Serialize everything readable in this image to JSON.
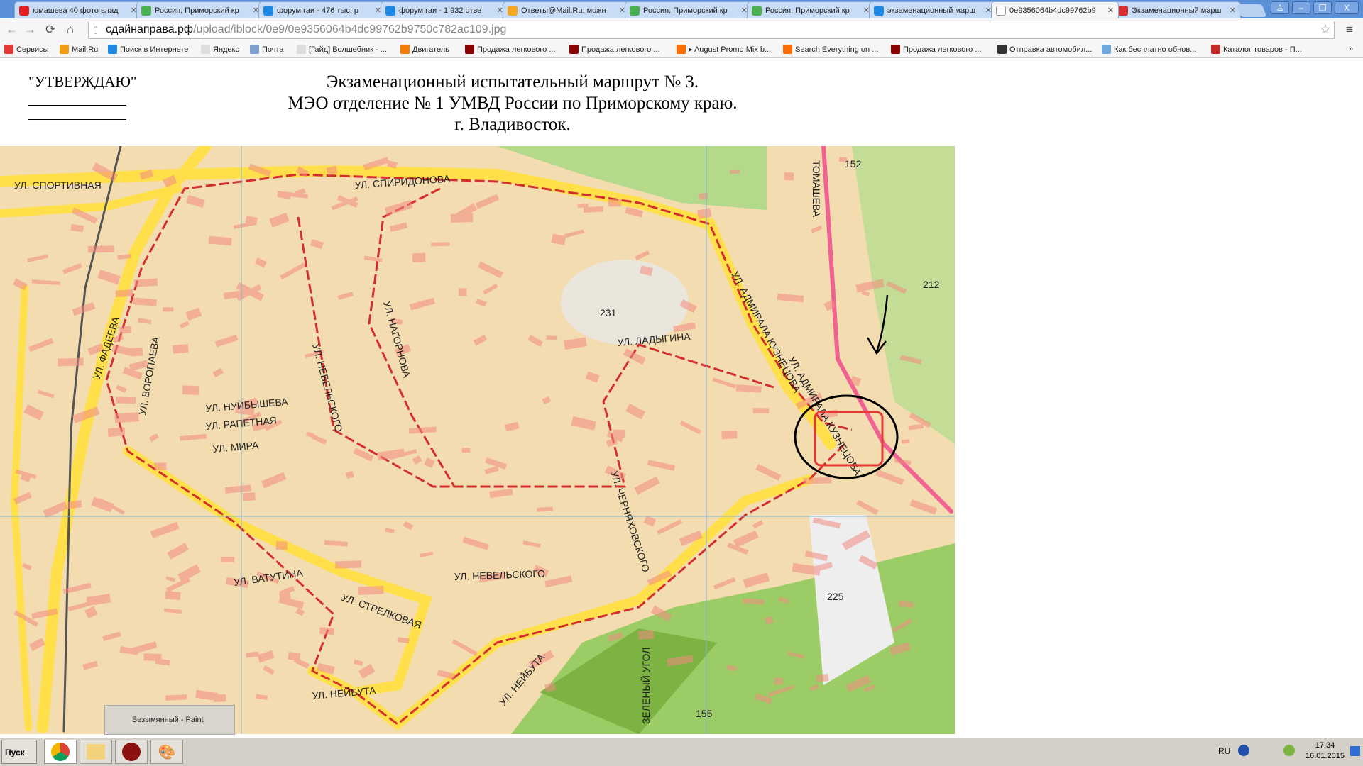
{
  "browser": {
    "tabs": [
      {
        "label": "юмашева 40 фото влад",
        "icon": "yandex-icon",
        "color": "#e02020",
        "active": false
      },
      {
        "label": "Россия, Приморский кр",
        "icon": "2gis-icon",
        "color": "#4caf50",
        "active": false
      },
      {
        "label": "форум гаи - 476 тыс. р",
        "icon": "search-icon",
        "color": "#1e88e5",
        "active": false
      },
      {
        "label": "форум гаи - 1 932 отве",
        "icon": "search-icon",
        "color": "#1e88e5",
        "active": false
      },
      {
        "label": "Ответы@Mail.Ru: можн",
        "icon": "question-icon",
        "color": "#f5a623",
        "active": false
      },
      {
        "label": "Россия, Приморский кр",
        "icon": "2gis-icon",
        "color": "#4caf50",
        "active": false
      },
      {
        "label": "Россия, Приморский кр",
        "icon": "2gis-icon",
        "color": "#4caf50",
        "active": false
      },
      {
        "label": "экзаменационный марш",
        "icon": "search-icon",
        "color": "#1e88e5",
        "active": false
      },
      {
        "label": "0e9356064b4dc99762b9",
        "icon": "file-icon",
        "color": "#ffffff",
        "active": true
      },
      {
        "label": "Экзаменационный марш",
        "icon": "site-icon",
        "color": "#d32f2f",
        "active": false
      }
    ],
    "address": {
      "host": "сдайнаправа.рф",
      "path": "/upload/iblock/0e9/0e9356064b4dc99762b9750c782ac109.jpg"
    },
    "bookmarks": [
      {
        "label": "Сервисы",
        "color": "#e53935"
      },
      {
        "label": "Mail.Ru",
        "color": "#f39c12"
      },
      {
        "label": "Поиск в Интернете",
        "color": "#1e88e5"
      },
      {
        "label": "Яндекс",
        "color": "#dddddd"
      },
      {
        "label": "Почта",
        "color": "#7f9fd0"
      },
      {
        "label": "[Гайд] Волшебник - ...",
        "color": "#dddddd"
      },
      {
        "label": "Двигатель",
        "color": "#f57c00"
      },
      {
        "label": "Продажа легкового ...",
        "color": "#8b0000"
      },
      {
        "label": "Продажа легкового ...",
        "color": "#8b0000"
      },
      {
        "label": "▸ August Promo Mix b...",
        "color": "#ff6d00"
      },
      {
        "label": "Search Everything on ...",
        "color": "#ff6d00"
      },
      {
        "label": "Продажа легкового ...",
        "color": "#8b0000"
      },
      {
        "label": "Отправка автомобил...",
        "color": "#333333"
      },
      {
        "label": "Как бесплатно обнов...",
        "color": "#6fa8dc"
      },
      {
        "label": "Каталог товаров - П...",
        "color": "#c62828"
      }
    ],
    "bookmarks_more": "»"
  },
  "document": {
    "approve": "\"УТВЕРЖДАЮ\"",
    "title_lines": [
      "Экзаменационный испытательный маршрут № 3.",
      "МЭО отделение № 1 УМВД России по Приморскому краю.",
      "г. Владивосток."
    ]
  },
  "map": {
    "streets": [
      "УЛ. СПОРТИВНАЯ",
      "УЛ. СПИРИДОНОВА",
      "УЛ. ФАДЕЕВА",
      "УЛ. ВОРОПАЕВА",
      "УЛ. НЕВЕЛЬСКОГО",
      "УЛ. НАГОРНОВА",
      "УЛ. АДМИРАЛА КУЗНЕЦОВА",
      "УЛ. ЛАДЫГИНА",
      "УЛ. НЕВЕЛЬСКОГО",
      "УЛ. СТРЕЛКОВАЯ",
      "УЛ. НЕЙБУТА",
      "УЛ. НЕЙБУТА",
      "УЛ. ЧЕРНЯХОВСКОГО",
      "УЛ. АДМИРАЛА КУЗНЕЦОВА",
      "ЗЕЛЕНЫЙ УГОЛ",
      "УЛ. НУЙБЫШЕВА",
      "УЛ. РАПЕТНАЯ",
      "УЛ. МИРА",
      "УЛ. ВАТУТИНА",
      "ТОМАШЕВА"
    ],
    "labels": [
      "231",
      "225",
      "155",
      "152",
      "212"
    ],
    "route_color": "#d32f2f",
    "road_color": "#ffe04a",
    "green_color": "#9ccc65"
  },
  "taskbar": {
    "start": "Пуск",
    "popup": "Безымянный - Paint",
    "lang": "RU",
    "time": "17:34",
    "date": "16.01.2015"
  }
}
